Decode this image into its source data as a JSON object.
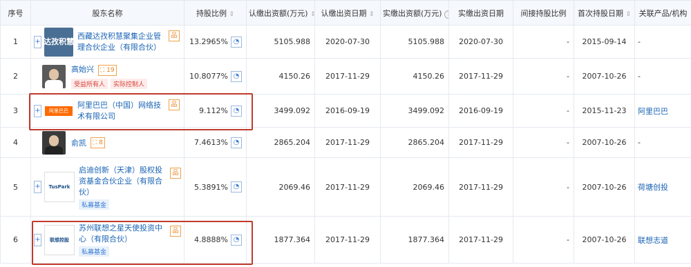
{
  "headers": {
    "idx": "序号",
    "name": "股东名称",
    "ratio": "持股比例",
    "sub_amount": "认缴出资额(万元)",
    "sub_date": "认缴出资日期",
    "paid_amount": "实缴出资额(万元)",
    "paid_date": "实缴出资日期",
    "indirect": "间接持股比例",
    "first_date": "首次持股日期",
    "related": "关联产品/机构"
  },
  "rows": [
    {
      "idx": "1",
      "logo_text": "达孜积慧",
      "name": "西藏达孜积慧聚集企业管理合伙企业（有限合伙）",
      "ratio": "13.2965%",
      "sub_amount": "5105.988",
      "sub_date": "2020-07-30",
      "paid_amount": "5105.988",
      "paid_date": "2020-07-30",
      "indirect": "-",
      "first_date": "2015-09-14",
      "related": "-"
    },
    {
      "idx": "2",
      "name": "高始兴",
      "rel_count": "19",
      "badges": [
        "受益所有人",
        "实际控制人"
      ],
      "ratio": "10.8077%",
      "sub_amount": "4150.26",
      "sub_date": "2017-11-29",
      "paid_amount": "4150.26",
      "paid_date": "2017-11-29",
      "indirect": "-",
      "first_date": "2007-10-26",
      "related": "-"
    },
    {
      "idx": "3",
      "logo_text": "阿里巴巴",
      "name": "阿里巴巴（中国）网络技术有限公司",
      "ratio": "9.112%",
      "sub_amount": "3499.092",
      "sub_date": "2016-09-19",
      "paid_amount": "3499.092",
      "paid_date": "2016-09-19",
      "indirect": "-",
      "first_date": "2015-11-23",
      "related": "阿里巴巴"
    },
    {
      "idx": "4",
      "name": "俞凯",
      "rel_count": "8",
      "ratio": "7.4613%",
      "sub_amount": "2865.204",
      "sub_date": "2017-11-29",
      "paid_amount": "2865.204",
      "paid_date": "2017-11-29",
      "indirect": "-",
      "first_date": "2007-10-26",
      "related": "-"
    },
    {
      "idx": "5",
      "logo_text": "TusPark",
      "name": "启迪创新（天津）股权投资基金合伙企业（有限合伙）",
      "tag": "私募基金",
      "ratio": "5.3891%",
      "sub_amount": "2069.46",
      "sub_date": "2017-11-29",
      "paid_amount": "2069.46",
      "paid_date": "2017-11-29",
      "indirect": "-",
      "first_date": "2007-10-26",
      "related": "荷塘创投"
    },
    {
      "idx": "6",
      "logo_text": "联想控股",
      "name": "苏州联想之星天使投资中心（有限合伙）",
      "tag": "私募基金",
      "ratio": "4.8888%",
      "sub_amount": "1877.364",
      "sub_date": "2017-11-29",
      "paid_amount": "1877.364",
      "paid_date": "2017-11-29",
      "indirect": "-",
      "first_date": "2007-10-26",
      "related": "联想志道"
    }
  ],
  "colors": {
    "link": "#1a64b5",
    "highlight": "#c0392b",
    "header_bg": "#f5f8fc"
  }
}
